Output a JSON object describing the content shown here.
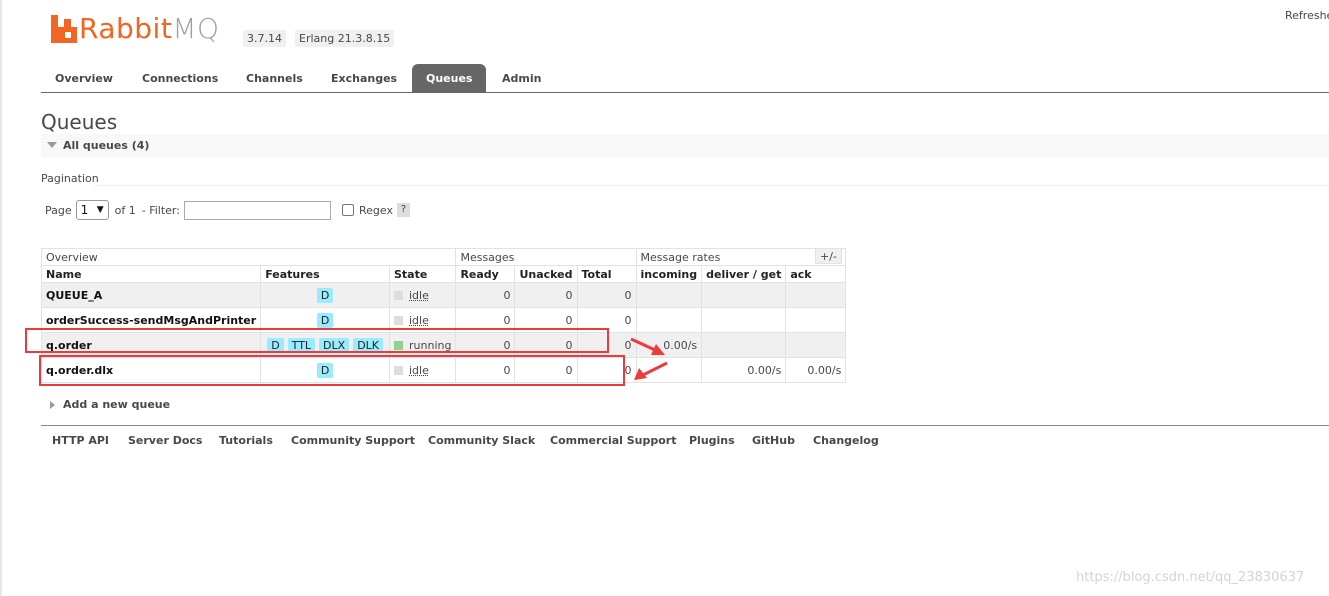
{
  "header": {
    "logo_text_a": "Rabbit",
    "logo_text_b": "MQ",
    "version": "3.7.14",
    "erlang": "Erlang 21.3.8.15",
    "refresh_label": "Refreshe"
  },
  "tabs": [
    {
      "label": "Overview",
      "active": false
    },
    {
      "label": "Connections",
      "active": false
    },
    {
      "label": "Channels",
      "active": false
    },
    {
      "label": "Exchanges",
      "active": false
    },
    {
      "label": "Queues",
      "active": true
    },
    {
      "label": "Admin",
      "active": false
    }
  ],
  "page": {
    "title": "Queues",
    "section_label": "All queues (4)",
    "pagination_label": "Pagination",
    "page_label": "Page",
    "page_value": "1",
    "of_label": "of 1",
    "filter_label": "- Filter:",
    "filter_value": "",
    "regex_label": "Regex",
    "help_label": "?"
  },
  "table": {
    "groups": [
      "Overview",
      "Messages",
      "Message rates"
    ],
    "columns": [
      "Name",
      "Features",
      "State",
      "Ready",
      "Unacked",
      "Total",
      "incoming",
      "deliver / get",
      "ack"
    ],
    "plus_minus": "+/-",
    "rows": [
      {
        "name": "QUEUE_A",
        "features": [
          "D"
        ],
        "state": "idle",
        "ready": "0",
        "unacked": "0",
        "total": "0",
        "incoming": "",
        "deliver_get": "",
        "ack": ""
      },
      {
        "name": "orderSuccess-sendMsgAndPrinter",
        "features": [
          "D"
        ],
        "state": "idle",
        "ready": "0",
        "unacked": "0",
        "total": "0",
        "incoming": "",
        "deliver_get": "",
        "ack": ""
      },
      {
        "name": "q.order",
        "features": [
          "D",
          "TTL",
          "DLX",
          "DLK"
        ],
        "state": "running",
        "ready": "0",
        "unacked": "0",
        "total": "0",
        "incoming": "0.00/s",
        "deliver_get": "",
        "ack": ""
      },
      {
        "name": "q.order.dlx",
        "features": [
          "D"
        ],
        "state": "idle",
        "ready": "0",
        "unacked": "0",
        "total": "0",
        "incoming": "",
        "deliver_get": "0.00/s",
        "ack": "0.00/s"
      }
    ]
  },
  "add_queue_label": "Add a new queue",
  "footer_links": [
    "HTTP API",
    "Server Docs",
    "Tutorials",
    "Community Support",
    "Community Slack",
    "Commercial Support",
    "Plugins",
    "GitHub",
    "Changelog"
  ],
  "watermark": "https://blog.csdn.net/qq_23830637",
  "colors": {
    "brand": "#f26522",
    "tab_active": "#666666",
    "feature_badge": "#99ebff",
    "state_running": "#8fd18f",
    "state_idle": "#dddddd",
    "annotation": "#ee3a3a"
  }
}
